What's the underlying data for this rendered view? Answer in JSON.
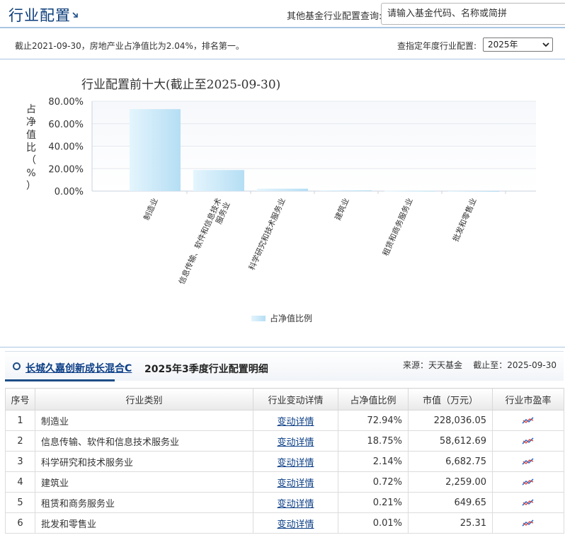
{
  "header": {
    "title": "行业配置",
    "search_label": "其他基金行业配置查询:",
    "search_placeholder": "请输入基金代码、名称或简拼"
  },
  "info_bar": {
    "summary": "截止2021-09-30，房地产业占净值比为2.04%，排名第一。",
    "year_label": "查指定年度行业配置:",
    "year_selected": "2025年"
  },
  "chart_data": {
    "type": "bar",
    "title": "行业配置前十大(截止至2025-09-30)",
    "ylabel": "占净值比（%）",
    "ylim": [
      0,
      80
    ],
    "yticks": [
      "0.00%",
      "20.00%",
      "40.00%",
      "60.00%",
      "80.00%"
    ],
    "categories": [
      "制造业",
      "信息传输、软件和信息技术服务业",
      "科学研究和技术服务业",
      "建筑业",
      "租赁和商务服务业",
      "批发和零售业"
    ],
    "values": [
      72.94,
      18.75,
      2.14,
      0.72,
      0.21,
      0.01
    ],
    "legend": "占净值比例",
    "legend_position": "bottom-center",
    "bar_color": "#c3e6f7"
  },
  "detail": {
    "fund_name": "长城久嘉创新成长混合C",
    "title": "2025年3季度行业配置明细",
    "source": "来源：天天基金    截止至：2025-09-30",
    "columns": [
      "序号",
      "行业类别",
      "行业变动详情",
      "占净值比例",
      "市值（万元）",
      "行业市盈率"
    ],
    "link_label": "变动详情",
    "rows": [
      {
        "no": "1",
        "industry": "制造业",
        "ratio": "72.94%",
        "value": "228,036.05"
      },
      {
        "no": "2",
        "industry": "信息传输、软件和信息技术服务业",
        "ratio": "18.75%",
        "value": "58,612.69"
      },
      {
        "no": "3",
        "industry": "科学研究和技术服务业",
        "ratio": "2.14%",
        "value": "6,682.75"
      },
      {
        "no": "4",
        "industry": "建筑业",
        "ratio": "0.72%",
        "value": "2,259.00"
      },
      {
        "no": "5",
        "industry": "租赁和商务服务业",
        "ratio": "0.21%",
        "value": "649.65"
      },
      {
        "no": "6",
        "industry": "批发和零售业",
        "ratio": "0.01%",
        "value": "25.31"
      }
    ]
  },
  "icons": {
    "title_arrow": "arrow-down-right-icon",
    "select_chevron": "chevron-down-icon",
    "bullet": "circle-bullet-icon",
    "pe": "trend-chart-icon"
  }
}
